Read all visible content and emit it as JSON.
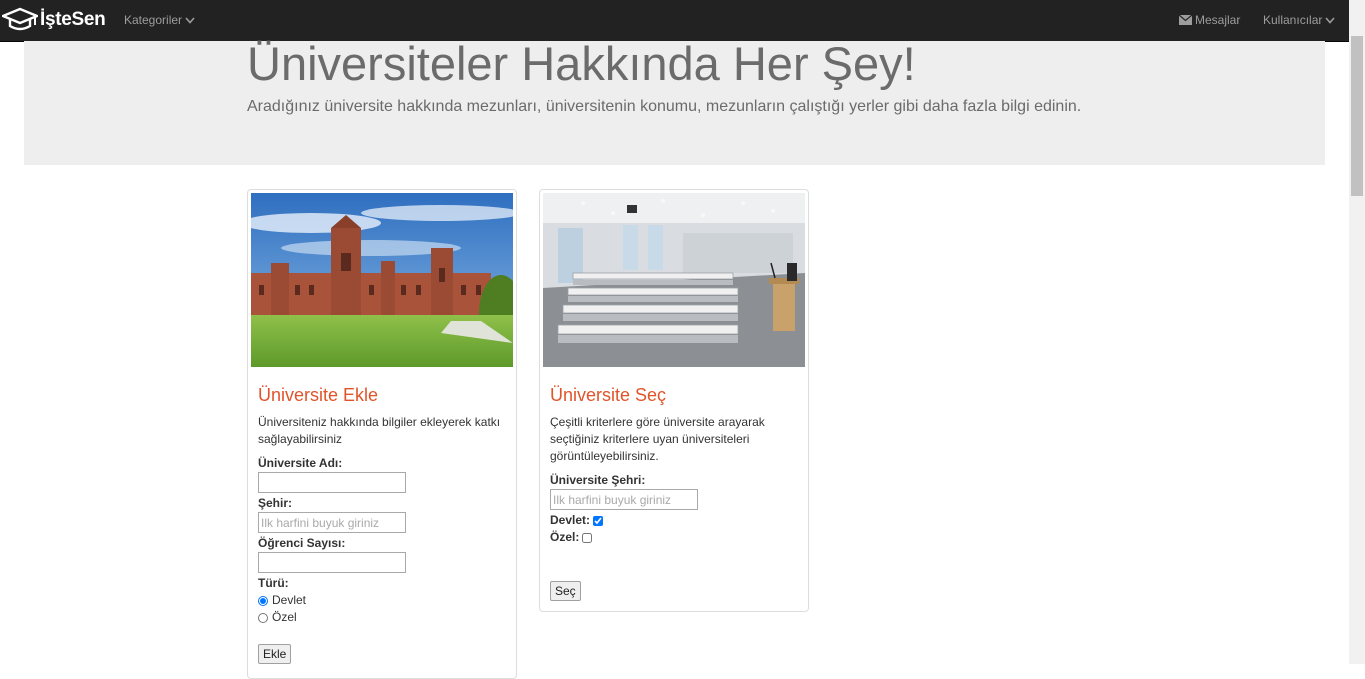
{
  "navbar": {
    "brand": "İşteSen",
    "kategoriler": "Kategoriler",
    "mesajlar": "Mesajlar",
    "kullanicilar": "Kullanıcılar"
  },
  "jumbotron": {
    "title": "Üniversiteler Hakkında Her Şey!",
    "subtitle": "Aradığınız üniversite hakkında mezunları, üniversitenin konumu, mezunların çalıştığı yerler gibi daha fazla bilgi edinin."
  },
  "add_card": {
    "title": "Üniversite Ekle",
    "description": "Üniversiteniz hakkında bilgiler ekleyerek katkı sağlayabilirsiniz",
    "name_label": "Üniversite Adı:",
    "name_value": "",
    "city_label": "Şehir:",
    "city_placeholder": "Ilk harfini buyuk giriniz",
    "students_label": "Öğrenci Sayısı:",
    "students_value": "",
    "type_label": "Türü:",
    "type_options": [
      "Devlet",
      "Özel"
    ],
    "type_selected": "Devlet",
    "button": "Ekle"
  },
  "select_card": {
    "title": "Üniversite Seç",
    "description": "Çeşitli kriterlere göre üniversite arayarak seçtiğiniz kriterlere uyan üniversiteleri görüntüleyebilirsiniz.",
    "city_label": "Üniversite Şehri:",
    "city_placeholder": "Ilk harfini buyuk giriniz",
    "devlet_label": "Devlet:",
    "devlet_checked": true,
    "ozel_label": "Özel:",
    "ozel_checked": false,
    "button": "Seç"
  },
  "colors": {
    "navbar_bg": "#222222",
    "nav_text": "#9d9d9d",
    "jumbotron_bg": "#eeeeee",
    "accent_heading": "#e0542a"
  }
}
